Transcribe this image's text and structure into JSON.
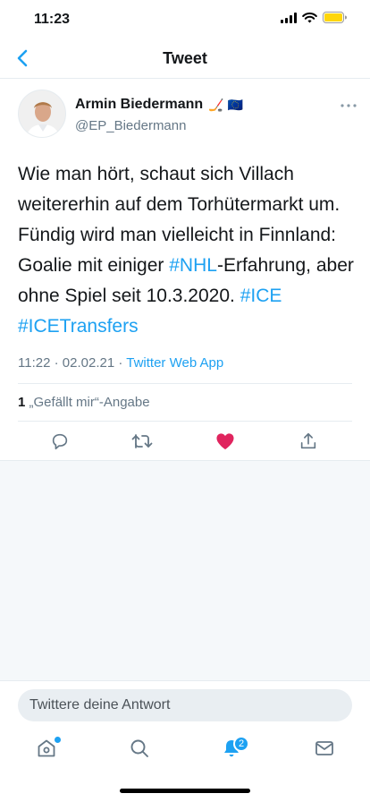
{
  "status_bar": {
    "time": "11:23"
  },
  "nav": {
    "title": "Tweet"
  },
  "tweet": {
    "author_name": "Armin Biedermann",
    "author_emojis": "🏒 🇪🇺",
    "author_handle": "@EP_Biedermann",
    "text": {
      "part1": "Wie man hört, schaut sich Villach weitererhin auf dem Torhütermarkt um. Fündig wird man vielleicht in Finnland:  Goalie mit einiger ",
      "hashtag1": "#NHL",
      "part2": "-Erfahrung, aber ohne Spiel seit 10.3.2020. ",
      "hashtag2": "#ICE",
      "space": " ",
      "hashtag3": "#ICETransfers"
    },
    "time": "11:22",
    "dot": "·",
    "date": "02.02.21",
    "source": "Twitter Web App",
    "like_count": "1",
    "like_label": "„Gefällt mir“-Angabe"
  },
  "reply": {
    "placeholder": "Twittere deine Antwort"
  },
  "tabs": {
    "notifications_badge": "2"
  },
  "colors": {
    "accent": "#1da1f2",
    "like": "#e0245e",
    "text_secondary": "#657786"
  },
  "icons": [
    "back-chevron-icon",
    "more-icon",
    "reply-icon",
    "retweet-icon",
    "like-heart-icon",
    "share-icon",
    "home-icon",
    "search-icon",
    "notifications-bell-icon",
    "messages-icon"
  ]
}
